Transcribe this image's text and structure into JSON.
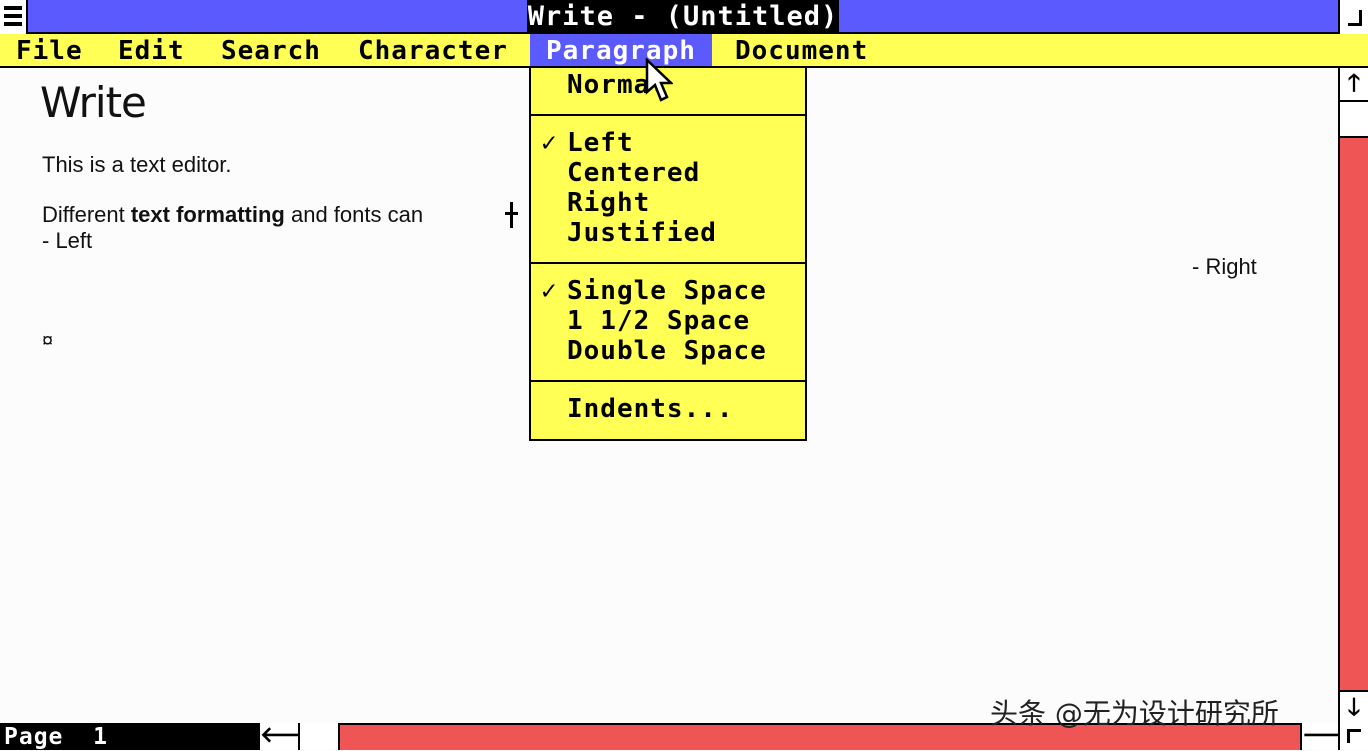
{
  "window": {
    "title": "Write - (Untitled)"
  },
  "menubar": {
    "items": [
      "File",
      "Edit",
      "Search",
      "Character",
      "Paragraph",
      "Document"
    ],
    "active": "Paragraph"
  },
  "paragraph_menu": {
    "groups": [
      [
        {
          "label": "Normal",
          "checked": false
        }
      ],
      [
        {
          "label": "Left",
          "checked": true
        },
        {
          "label": "Centered",
          "checked": false
        },
        {
          "label": "Right",
          "checked": false
        },
        {
          "label": "Justified",
          "checked": false
        }
      ],
      [
        {
          "label": "Single Space",
          "checked": true
        },
        {
          "label": "1 1/2 Space",
          "checked": false
        },
        {
          "label": "Double Space",
          "checked": false
        }
      ],
      [
        {
          "label": "Indents...",
          "checked": false
        }
      ]
    ],
    "check_glyph": "✓"
  },
  "document": {
    "heading": "Write",
    "line1": "This is a text editor.",
    "line2_prefix": "Different ",
    "line2_bold": "text formatting",
    "line2_suffix": " and fonts can",
    "line3": "- Left",
    "line4": "- Right",
    "end_mark": "¤"
  },
  "status": {
    "page": "Page  1"
  },
  "scroll": {
    "up_arrow": "🡑",
    "down_arrow": "🡓",
    "left_arrow": "🡐",
    "right_arrow": "🡒"
  },
  "watermark": "头条 @无为设计研究所",
  "colors": {
    "titlebar": "#5a5aff",
    "menubar": "#ffff55",
    "scrollbar": "#f05555"
  },
  "icons": {
    "system_menu": "hamburger-icon",
    "cursor": "arrow-cursor-icon",
    "text_cursor": "ibeam-cursor-icon"
  }
}
